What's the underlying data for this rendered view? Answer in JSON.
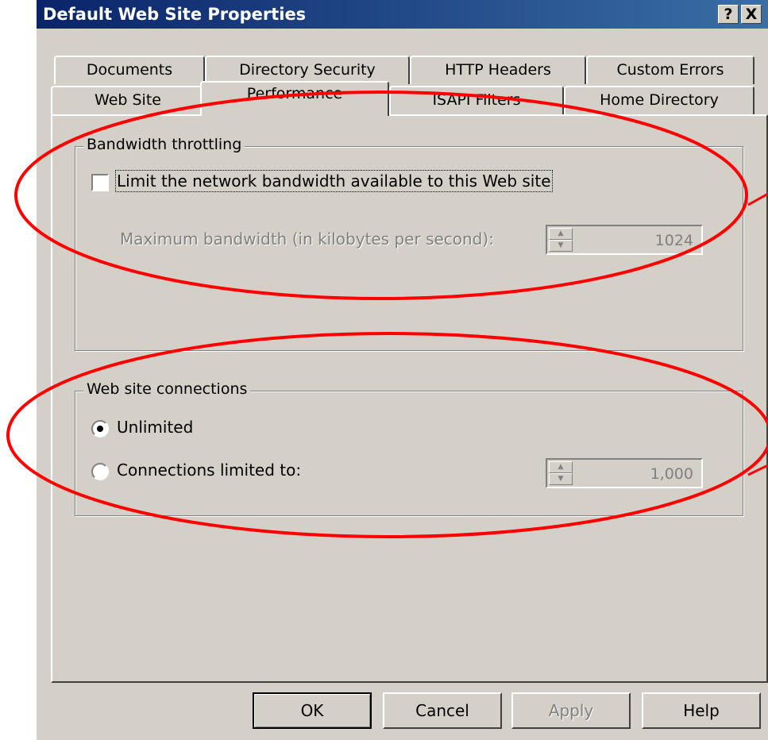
{
  "window": {
    "title": "Default Web Site Properties",
    "help_button": "?",
    "close_button": "X"
  },
  "tabs": {
    "row1": [
      "Documents",
      "Directory Security",
      "HTTP Headers",
      "Custom Errors"
    ],
    "row2": [
      "Web Site",
      "Performance",
      "ISAPI Filters",
      "Home Directory"
    ],
    "active": "Performance"
  },
  "bandwidth": {
    "group_label": "Bandwidth throttling",
    "checkbox_label": "Limit the network bandwidth available to this Web site",
    "checked": false,
    "max_label": "Maximum bandwidth (in kilobytes per second):",
    "max_value": "1024"
  },
  "connections": {
    "group_label": "Web site connections",
    "unlimited_label": "Unlimited",
    "limited_label": "Connections limited to:",
    "selected": "Unlimited",
    "limit_value": "1,000"
  },
  "buttons": {
    "ok": "OK",
    "cancel": "Cancel",
    "apply": "Apply",
    "help": "Help"
  },
  "annotation_color": "#ff0000",
  "title_gradient": [
    "#0a246a",
    "#3a6ea5"
  ]
}
